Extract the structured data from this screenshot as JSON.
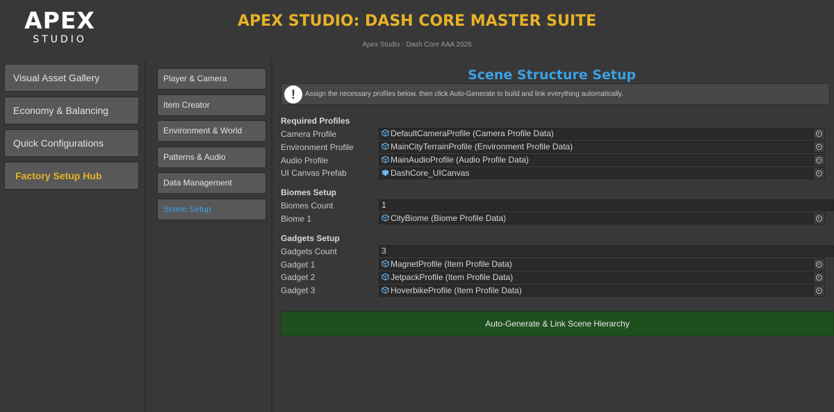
{
  "header": {
    "logo_main": "APEX",
    "logo_sub": "STUDIO",
    "title": "APEX STUDIO: DASH CORE MASTER SUITE",
    "subtitle": "Apex Studio - Dash Core AAA 2026"
  },
  "categories": [
    {
      "label": "Visual Asset Gallery",
      "active": false
    },
    {
      "label": "Economy & Balancing",
      "active": false
    },
    {
      "label": "Quick Configurations",
      "active": false
    },
    {
      "label": "Factory Setup Hub",
      "active": true
    }
  ],
  "submenu": [
    {
      "label": "Player & Camera",
      "active": false
    },
    {
      "label": "Item Creator",
      "active": false
    },
    {
      "label": "Environment & World",
      "active": false
    },
    {
      "label": "Patterns & Audio",
      "active": false
    },
    {
      "label": "Data Management",
      "active": false
    },
    {
      "label": "Scene Setup",
      "active": true
    }
  ],
  "main": {
    "title": "Scene Structure Setup",
    "info_icon": "!",
    "info_text": "Assign the necessary profiles below, then click Auto-Generate to build and link everything automatically.",
    "required_profiles": {
      "heading": "Required Profiles",
      "rows": [
        {
          "label": "Camera Profile",
          "value": "DefaultCameraProfile (Camera Profile Data)",
          "icon": "scriptable-object-icon"
        },
        {
          "label": "Environment Profile",
          "value": "MainCityTerrainProfile (Environment Profile Data)",
          "icon": "scriptable-object-icon"
        },
        {
          "label": "Audio Profile",
          "value": "MainAudioProfile (Audio Profile Data)",
          "icon": "scriptable-object-icon"
        },
        {
          "label": "UI Canvas Prefab",
          "value": "DashCore_UICanvas",
          "icon": "prefab-icon"
        }
      ]
    },
    "biomes": {
      "heading": "Biomes Setup",
      "count_label": "Biomes Count",
      "count_value": "1",
      "rows": [
        {
          "label": "Biome 1",
          "value": "CityBiome (Biome Profile Data)",
          "icon": "scriptable-object-icon"
        }
      ]
    },
    "gadgets": {
      "heading": "Gadgets Setup",
      "count_label": "Gadgets Count",
      "count_value": "3",
      "rows": [
        {
          "label": "Gadget 1",
          "value": "MagnetProfile (Item Profile Data)",
          "icon": "scriptable-object-icon"
        },
        {
          "label": "Gadget 2",
          "value": "JetpackProfile (Item Profile Data)",
          "icon": "scriptable-object-icon"
        },
        {
          "label": "Gadget 3",
          "value": "HoverbikeProfile (Item Profile Data)",
          "icon": "scriptable-object-icon"
        }
      ]
    },
    "generate_button": "Auto-Generate & Link Scene Hierarchy"
  },
  "colors": {
    "background": "#383838",
    "accent_gold": "#e8b227",
    "accent_blue": "#3aa2e6",
    "button_green": "#1f4f1f",
    "field_dark": "#2a2a2a"
  }
}
